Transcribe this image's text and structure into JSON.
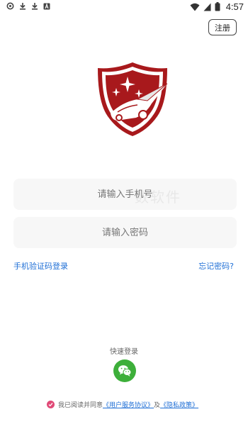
{
  "status_bar": {
    "time": "4:57",
    "left_icons": [
      "sync-icon",
      "download-icon",
      "download-icon",
      "notification-a-icon"
    ],
    "right_icons": [
      "wifi-icon",
      "signal-icon",
      "battery-icon"
    ]
  },
  "header": {
    "register_label": "注册"
  },
  "logo": {
    "icon": "shield-car-logo",
    "color": "#a8191c"
  },
  "form": {
    "phone_placeholder": "请输入手机号",
    "password_placeholder": "请输入密码"
  },
  "watermark": "数软件",
  "links": {
    "sms_login": "手机验证码登录",
    "forgot_password": "忘记密码?"
  },
  "quick_login": {
    "label": "快速登录",
    "icon": "wechat-icon",
    "color": "#3daf3a"
  },
  "agreement": {
    "prefix": "我已阅读并同意",
    "terms": "《用户服务协议》",
    "and": "及",
    "privacy": "《隐私政策》",
    "check_color": "#e04a77"
  },
  "colors": {
    "link": "#1f6fd6",
    "background": "#ffffff",
    "field": "#f7f7f7"
  }
}
